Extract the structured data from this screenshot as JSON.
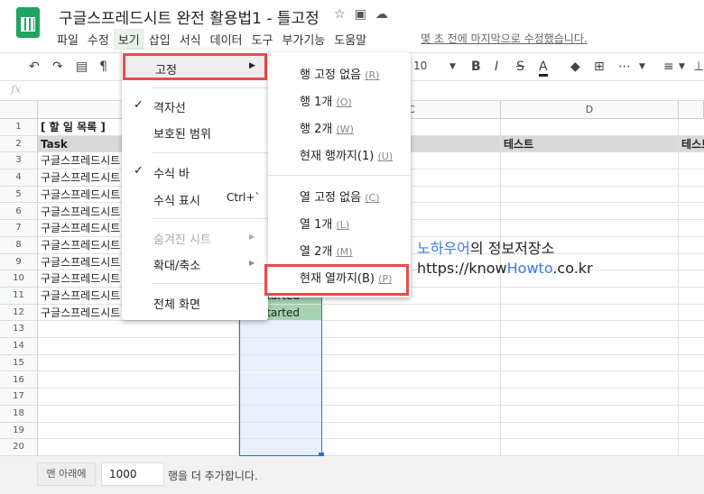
{
  "title": "구글스프레드시트 완전 활용법1 - 틀고정",
  "menubar": [
    "파일",
    "수정",
    "보기",
    "삽입",
    "서식",
    "데이터",
    "도구",
    "부가기능",
    "도움말"
  ],
  "saved_status": "몇 초 전에 마지막으로 수정했습니다.",
  "toolbar": {
    "font_size": "10"
  },
  "fx_label": "fx",
  "columns": [
    "C",
    "D"
  ],
  "rows": [
    "1",
    "2",
    "3",
    "4",
    "5",
    "6",
    "7",
    "8",
    "9",
    "10",
    "11",
    "12",
    "13",
    "14",
    "15",
    "16",
    "17",
    "18",
    "19",
    "20"
  ],
  "cells": {
    "a1": "[ 할 일 목록 ]",
    "a2": "Task",
    "task": "구글스프레드시트",
    "d2": "테스트",
    "e2": "테스트",
    "status": "tarted"
  },
  "view_menu": {
    "freeze": "고정",
    "gridlines": "격자선",
    "protected": "보호된 범위",
    "formula_bar": "수식 바",
    "show_formulas": "수식 표시",
    "show_formulas_shortcut": "Ctrl+`",
    "hidden_sheets": "숨겨진 시트",
    "zoom": "확대/축소",
    "fullscreen": "전체 화면"
  },
  "freeze_menu": [
    {
      "label": "행 고정 없음",
      "key": "(R)"
    },
    {
      "label": "행 1개",
      "key": "(O)"
    },
    {
      "label": "행 2개",
      "key": "(W)"
    },
    {
      "label": "현재 행까지(1)",
      "key": "(U)"
    },
    {
      "label": "열 고정 없음",
      "key": "(C)"
    },
    {
      "label": "열 1개",
      "key": "(L)"
    },
    {
      "label": "열 2개",
      "key": "(M)"
    },
    {
      "label": "현재 열까지(B)",
      "key": "(P)"
    }
  ],
  "watermark": {
    "line1_brand": "노하우어",
    "line1_rest": "의 정보저장소",
    "line2_a": "https://know",
    "line2_b": "Howto",
    "line2_c": ".co.kr"
  },
  "footer": {
    "button": "맨 아래에",
    "rows_value": "1000",
    "suffix": "행을 더 추가합니다."
  },
  "colors": {
    "green": "#0f9d58",
    "highlight_red": "#e84c4c",
    "selection": "#1a73e8",
    "status_fill": "#a8d1b0"
  }
}
